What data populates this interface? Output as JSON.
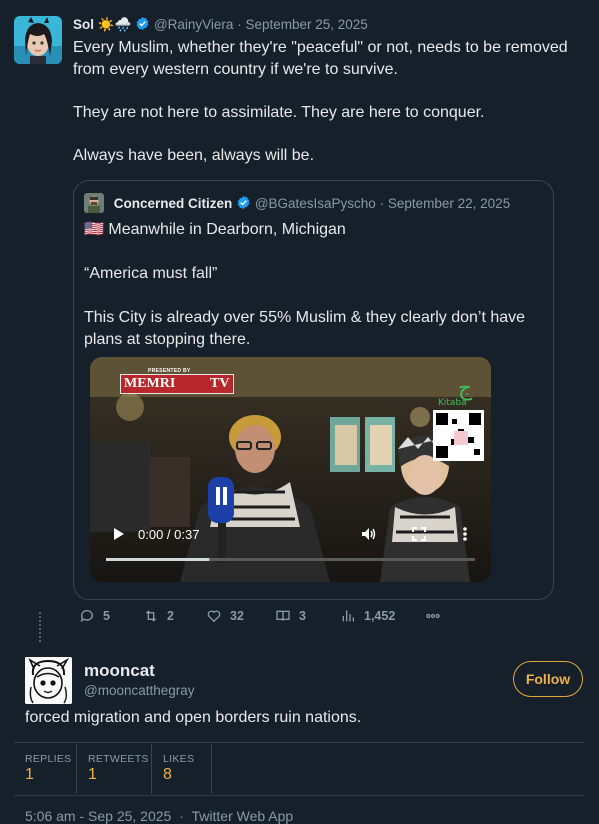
{
  "tweet": {
    "author_name": "Sol",
    "author_emoji": "☀️🌧️",
    "handle": "@RainyViera",
    "date": "September 25, 2025",
    "paragraphs": [
      "Every Muslim, whether they're \"peaceful\" or not, needs to be removed from every western country if we're to survive.",
      "They are not here to assimilate. They are here to conquer.",
      "Always have been, always will be."
    ]
  },
  "quote": {
    "author_name": "Concerned Citizen",
    "handle": "@BGatesIsaPyscho",
    "date": "September 22, 2025",
    "flag": "🇺🇸",
    "paragraphs": [
      "Meanwhile in Dearborn, Michigan",
      "“America must fall”",
      "This City is already over 55% Muslim & they clearly don’t have plans at stopping there."
    ],
    "video": {
      "time": "0:00 / 0:37",
      "watermark": "MEMRI",
      "watermark_suffix": "TV",
      "presented_by": "PRESENTED BY",
      "progress": 0.28
    }
  },
  "actions": {
    "replies": "5",
    "retweets": "2",
    "likes": "32",
    "bookmarks": "3",
    "views": "1,452"
  },
  "reply": {
    "name": "mooncat",
    "handle": "@mooncatthegray",
    "follow_label": "Follow",
    "text": "forced migration and open borders ruin nations."
  },
  "stats": {
    "replies_label": "REPLIES",
    "replies_value": "1",
    "retweets_label": "RETWEETS",
    "retweets_value": "1",
    "likes_label": "LIKES",
    "likes_value": "8"
  },
  "footer": {
    "timestamp": "5:06 am - Sep 25, 2025",
    "separator": "·",
    "source": "Twitter Web App"
  },
  "colors": {
    "background": "#15202b",
    "accent": "#f0b245",
    "verified": "#1d9bf0",
    "muted": "#8b98a5"
  }
}
